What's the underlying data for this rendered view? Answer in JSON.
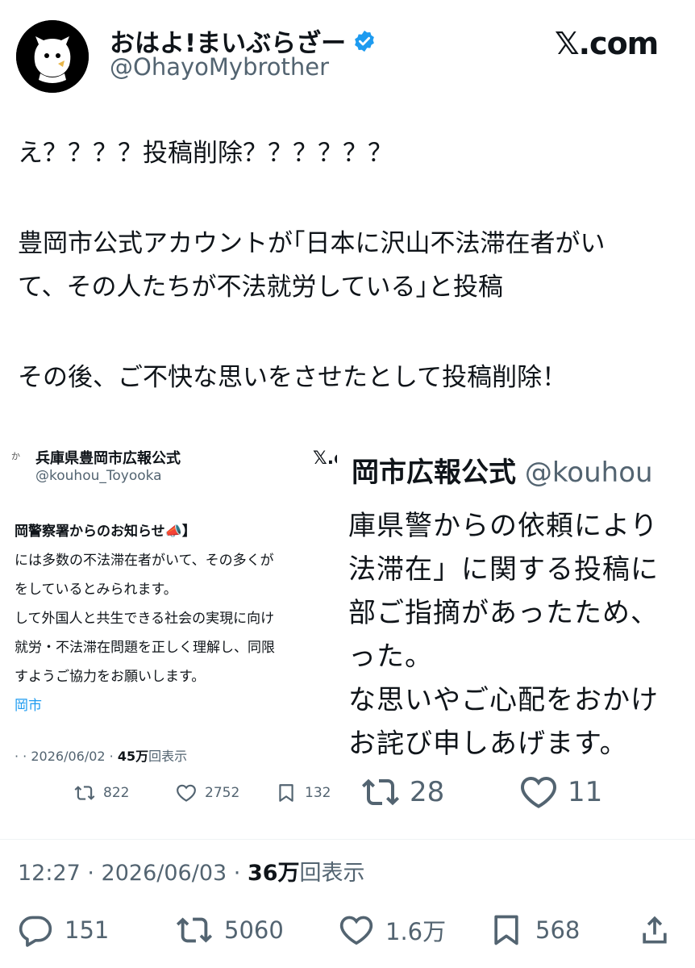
{
  "author": {
    "name": "おはよ!まいぶらざー",
    "handle": "@OhayoMybrother"
  },
  "brand": "𝕏.com",
  "tweet_lines": [
    "え？？？？投稿削除？？？？？？",
    "豊岡市公式アカウントが｢日本に沢山不法滞在者がい",
    "て、その人たちが不法就労している｣と投稿",
    "その後、ご不快な思いをさせたとして投稿削除！"
  ],
  "embed_left": {
    "icon_text": "か",
    "name": "兵庫県豊岡市広報公式",
    "handle": "@kouhou_Toyooka",
    "brand": "𝕏.c",
    "lines": [
      "岡警察署からのお知らせ📣】",
      "には多数の不法滞在者がいて、その多くが",
      "をしているとみられます。",
      "して外国人と共生できる社会の実現に向け",
      "就労・不法滞在問題を正しく理解し、同限",
      "すようご協力をお願いします。"
    ],
    "link": "岡市",
    "meta_prefix": "· · 2026/06/02 · ",
    "views_num": "45万",
    "views_label": "回表示",
    "retweets": "822",
    "likes": "2752",
    "bookmarks": "132"
  },
  "embed_right": {
    "header_name": "岡市広報公式",
    "header_handle": "@kouhou",
    "lines": [
      "庫県警からの依頼により",
      "法滞在」に関する投稿に",
      "部ご指摘があったため、",
      "った。",
      "な思いやご心配をおかけ",
      "お詫び申しあげます。"
    ],
    "retweets": "28",
    "likes": "11"
  },
  "timestamp": {
    "time_date": "12:27 · 2026/06/03 · ",
    "views_num": "36万",
    "views_label": "回表示"
  },
  "actions": {
    "replies": "151",
    "retweets": "5060",
    "likes": "1.6万",
    "bookmarks": "568"
  },
  "colors": {
    "text": "#0f1419",
    "secondary": "#536471",
    "link": "#1d9bf0",
    "verified": "#1d9bf0"
  }
}
